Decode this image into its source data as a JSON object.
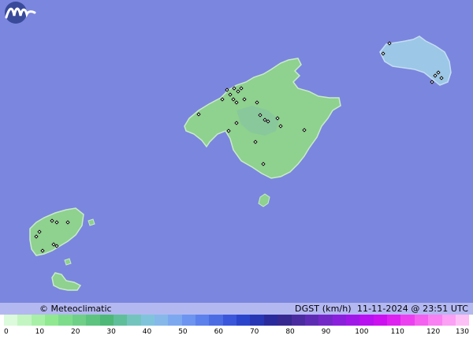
{
  "map": {
    "sea_color": "#7b86df",
    "island_color": "#8fd18f",
    "menorca_color": "#9cc7e6"
  },
  "footer": {
    "credit": "© Meteoclimatic",
    "variable": "DGST (km/h)",
    "datetime": "11-11-2024 @ 23:51 UTC"
  },
  "scale": {
    "ticks": [
      "0",
      "10",
      "20",
      "30",
      "40",
      "50",
      "60",
      "70",
      "80",
      "90",
      "100",
      "110",
      "120",
      "130"
    ],
    "colors": [
      "#dcfadc",
      "#c2f5c2",
      "#a8f0a8",
      "#90e890",
      "#7ddc8c",
      "#6ed086",
      "#5cc47e",
      "#4eb878",
      "#5fbf9a",
      "#74c4be",
      "#80c4dc",
      "#86b8ea",
      "#7ca8f0",
      "#6c94f0",
      "#5c80ec",
      "#4c6ce4",
      "#3a56da",
      "#2a44cc",
      "#2636b4",
      "#2a2a9c",
      "#362890",
      "#4a2ca0",
      "#5e2cb4",
      "#7428c8",
      "#8a20dc",
      "#a018e8",
      "#b810f0",
      "#cc10f0",
      "#de20f0",
      "#ec40f0",
      "#f460f0",
      "#f880f2",
      "#fba0f4",
      "#fdc0f6"
    ],
    "icon": "meteoclimatic-logo"
  },
  "stations": [
    {
      "name": "",
      "lon": 0,
      "lat": 0
    }
  ]
}
